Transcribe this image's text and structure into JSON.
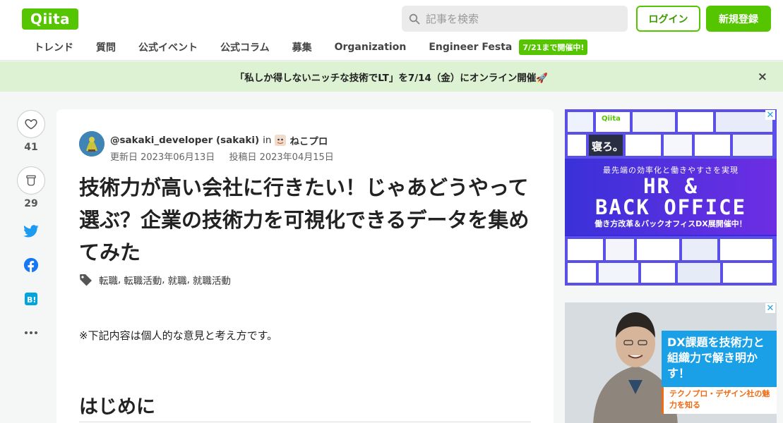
{
  "header": {
    "logo": "Qiita",
    "search_placeholder": "記事を検索",
    "login_label": "ログイン",
    "signup_label": "新規登録"
  },
  "nav": {
    "items": [
      "トレンド",
      "質問",
      "公式イベント",
      "公式コラム",
      "募集",
      "Organization",
      "Engineer Festa"
    ],
    "badge": "7/21まで開催中!"
  },
  "banner": {
    "text": "「私しか得しないニッチな技術でLT」を7/14（金）にオンライン開催🚀",
    "close": "×"
  },
  "actions": {
    "like_count": "41",
    "stock_count": "29",
    "share_icons": [
      "twitter-icon",
      "facebook-icon",
      "hatena-bookmark-icon",
      "more-icon"
    ]
  },
  "article": {
    "author": "@sakaki_developer (sakaki)",
    "in": "in",
    "organization": "ねこプロ",
    "updated": "更新日 2023年06月13日",
    "posted": "投稿日 2023年04月15日",
    "title": "技術力が高い会社に行きたい！じゃあどうやって選ぶ？企業の技術力を可視化できるデータを集めてみた",
    "tags": [
      "転職",
      "転職活動",
      "就職",
      "就職活動"
    ],
    "note": "※下記内容は個人的な意見と考え方です。",
    "heading": "はじめに"
  },
  "ads": {
    "ad1": {
      "subtitle": "最先端の効率化と働きやすさを実現",
      "headline_1": "HR &",
      "headline_2": "BACK OFFICE",
      "footer": "働き方改革＆バックオフィスDX展開催中！",
      "brand": "Qiita",
      "tile_text": "寝ろ。"
    },
    "ad2": {
      "headline": "DX課題を技術力と組織力で解き明かす！",
      "sub": "テクノプロ・デザイン社の魅力を知る"
    },
    "close_label": "✕"
  },
  "colors": {
    "brand_green": "#55c500",
    "banner_bg": "#ddf2d3",
    "twitter": "#1d9bf0",
    "facebook": "#1877f2",
    "hatena": "#00a4de"
  }
}
